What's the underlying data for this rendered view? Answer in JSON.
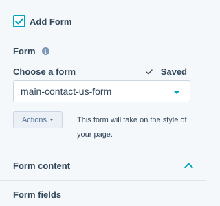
{
  "add_form": {
    "label": "Add Form",
    "checked": true,
    "icon": "checkmark-icon",
    "accent_color": "#00a4bd"
  },
  "form_section": {
    "label": "Form",
    "info_icon": "i"
  },
  "choose": {
    "label": "Choose a form",
    "status": "Saved",
    "status_icon": "checkmark-icon"
  },
  "select": {
    "value": "main-contact-us-form",
    "caret_icon": "caret-down-icon"
  },
  "actions": {
    "label": "Actions"
  },
  "help_text": "This form will take on the style of your page.",
  "form_content": {
    "title": "Form content",
    "chevron_icon": "chevron-up-icon"
  },
  "form_fields": {
    "label": "Form fields"
  },
  "colors": {
    "text": "#33475b",
    "accent": "#00a4bd",
    "background": "#f5f8fa"
  }
}
